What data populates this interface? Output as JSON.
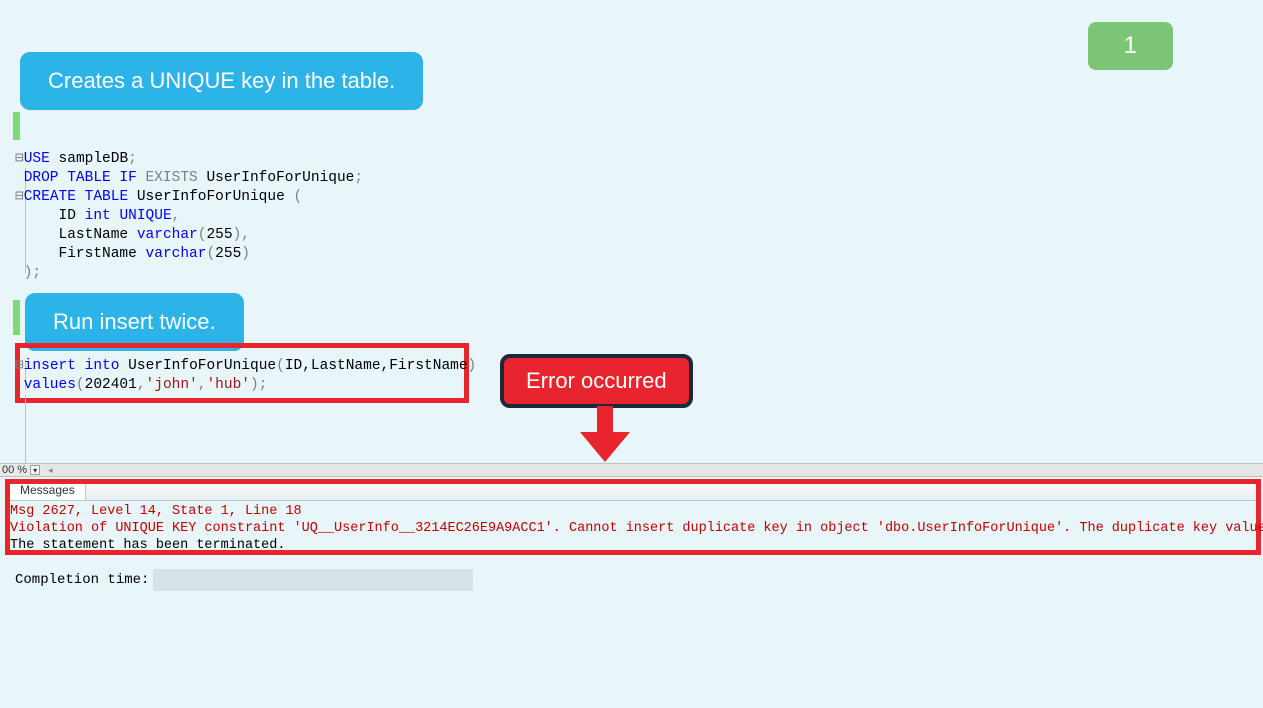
{
  "badge": {
    "number": "1"
  },
  "callouts": {
    "create_unique": "Creates a UNIQUE key in the table.",
    "run_insert": "Run insert twice.",
    "error_occurred": "Error occurred"
  },
  "sql": {
    "use": "USE",
    "db": "sampleDB",
    "drop_table": "DROP TABLE",
    "if": "IF",
    "exists": "EXISTS",
    "table1": "UserInfoForUnique",
    "create_table": "CREATE TABLE",
    "col_id": "ID",
    "int": "int",
    "unique": "UNIQUE",
    "col_last": "LastName",
    "varchar": "varchar",
    "vlen": "255",
    "col_first": "FirstName",
    "insert": "insert",
    "into": "into",
    "cols": "ID,LastName,FirstName",
    "values": "values",
    "v_id": "202401",
    "v_last": "'john'",
    "v_first": "'hub'"
  },
  "zoom": {
    "value": "00 %"
  },
  "messages": {
    "tab": "Messages",
    "line1": "Msg 2627, Level 14, State 1, Line 18",
    "line2": "Violation of UNIQUE KEY constraint 'UQ__UserInfo__3214EC26E9A9ACC1'. Cannot insert duplicate key in object 'dbo.UserInfoForUnique'. The duplicate key value i",
    "line3": "The statement has been terminated."
  },
  "completion": {
    "label": "Completion time:"
  }
}
